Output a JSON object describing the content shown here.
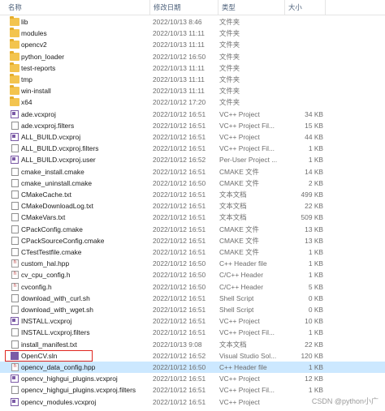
{
  "columns": {
    "name": "名称",
    "date": "修改日期",
    "type": "类型",
    "size": "大小"
  },
  "rows": [
    {
      "icon": "folder",
      "name": "lib",
      "date": "2022/10/13 8:46",
      "type": "文件夹",
      "size": ""
    },
    {
      "icon": "folder",
      "name": "modules",
      "date": "2022/10/13 11:11",
      "type": "文件夹",
      "size": ""
    },
    {
      "icon": "folder",
      "name": "opencv2",
      "date": "2022/10/13 11:11",
      "type": "文件夹",
      "size": ""
    },
    {
      "icon": "folder",
      "name": "python_loader",
      "date": "2022/10/12 16:50",
      "type": "文件夹",
      "size": ""
    },
    {
      "icon": "folder",
      "name": "test-reports",
      "date": "2022/10/13 11:11",
      "type": "文件夹",
      "size": ""
    },
    {
      "icon": "folder",
      "name": "tmp",
      "date": "2022/10/13 11:11",
      "type": "文件夹",
      "size": ""
    },
    {
      "icon": "folder",
      "name": "win-install",
      "date": "2022/10/13 11:11",
      "type": "文件夹",
      "size": ""
    },
    {
      "icon": "folder",
      "name": "x64",
      "date": "2022/10/12 17:20",
      "type": "文件夹",
      "size": ""
    },
    {
      "icon": "vc",
      "name": "ade.vcxproj",
      "date": "2022/10/12 16:51",
      "type": "VC++ Project",
      "size": "34 KB"
    },
    {
      "icon": "doc",
      "name": "ade.vcxproj.filters",
      "date": "2022/10/12 16:51",
      "type": "VC++ Project Fil...",
      "size": "15 KB"
    },
    {
      "icon": "vc",
      "name": "ALL_BUILD.vcxproj",
      "date": "2022/10/12 16:51",
      "type": "VC++ Project",
      "size": "44 KB"
    },
    {
      "icon": "doc",
      "name": "ALL_BUILD.vcxproj.filters",
      "date": "2022/10/12 16:51",
      "type": "VC++ Project Fil...",
      "size": "1 KB"
    },
    {
      "icon": "vc",
      "name": "ALL_BUILD.vcxproj.user",
      "date": "2022/10/12 16:52",
      "type": "Per-User Project ...",
      "size": "1 KB"
    },
    {
      "icon": "doc",
      "name": "cmake_install.cmake",
      "date": "2022/10/12 16:51",
      "type": "CMAKE 文件",
      "size": "14 KB"
    },
    {
      "icon": "doc",
      "name": "cmake_uninstall.cmake",
      "date": "2022/10/12 16:50",
      "type": "CMAKE 文件",
      "size": "2 KB"
    },
    {
      "icon": "doc",
      "name": "CMakeCache.txt",
      "date": "2022/10/12 16:51",
      "type": "文本文档",
      "size": "499 KB"
    },
    {
      "icon": "doc",
      "name": "CMakeDownloadLog.txt",
      "date": "2022/10/12 16:51",
      "type": "文本文档",
      "size": "22 KB"
    },
    {
      "icon": "doc",
      "name": "CMakeVars.txt",
      "date": "2022/10/12 16:51",
      "type": "文本文档",
      "size": "509 KB"
    },
    {
      "icon": "doc",
      "name": "CPackConfig.cmake",
      "date": "2022/10/12 16:51",
      "type": "CMAKE 文件",
      "size": "13 KB"
    },
    {
      "icon": "doc",
      "name": "CPackSourceConfig.cmake",
      "date": "2022/10/12 16:51",
      "type": "CMAKE 文件",
      "size": "13 KB"
    },
    {
      "icon": "doc",
      "name": "CTestTestfile.cmake",
      "date": "2022/10/12 16:51",
      "type": "CMAKE 文件",
      "size": "1 KB"
    },
    {
      "icon": "h",
      "name": "custom_hal.hpp",
      "date": "2022/10/12 16:50",
      "type": "C++ Header file",
      "size": "1 KB"
    },
    {
      "icon": "h",
      "name": "cv_cpu_config.h",
      "date": "2022/10/12 16:50",
      "type": "C/C++ Header",
      "size": "1 KB"
    },
    {
      "icon": "h",
      "name": "cvconfig.h",
      "date": "2022/10/12 16:50",
      "type": "C/C++ Header",
      "size": "5 KB"
    },
    {
      "icon": "doc",
      "name": "download_with_curl.sh",
      "date": "2022/10/12 16:51",
      "type": "Shell Script",
      "size": "0 KB"
    },
    {
      "icon": "doc",
      "name": "download_with_wget.sh",
      "date": "2022/10/12 16:51",
      "type": "Shell Script",
      "size": "0 KB"
    },
    {
      "icon": "vc",
      "name": "INSTALL.vcxproj",
      "date": "2022/10/12 16:51",
      "type": "VC++ Project",
      "size": "10 KB"
    },
    {
      "icon": "doc",
      "name": "INSTALL.vcxproj.filters",
      "date": "2022/10/12 16:51",
      "type": "VC++ Project Fil...",
      "size": "1 KB"
    },
    {
      "icon": "doc",
      "name": "install_manifest.txt",
      "date": "2022/10/13 9:08",
      "type": "文本文档",
      "size": "22 KB"
    },
    {
      "icon": "sln",
      "name": "OpenCV.sln",
      "date": "2022/10/12 16:52",
      "type": "Visual Studio Sol...",
      "size": "120 KB"
    },
    {
      "icon": "h",
      "name": "opencv_data_config.hpp",
      "date": "2022/10/12 16:50",
      "type": "C++ Header file",
      "size": "1 KB"
    },
    {
      "icon": "vc",
      "name": "opencv_highgui_plugins.vcxproj",
      "date": "2022/10/12 16:51",
      "type": "VC++ Project",
      "size": "12 KB"
    },
    {
      "icon": "doc",
      "name": "opencv_highgui_plugins.vcxproj.filters",
      "date": "2022/10/12 16:51",
      "type": "VC++ Project Fil...",
      "size": "1 KB"
    },
    {
      "icon": "vc",
      "name": "opencv_modules.vcxproj",
      "date": "2022/10/12 16:51",
      "type": "VC++ Project",
      "size": ""
    }
  ],
  "selected_index": 30,
  "highlighted_index": 29,
  "watermark": "CSDN @python小广",
  "colors": {
    "selection": "#cce8ff",
    "highlight_border": "#e0261f",
    "folder": "#f3c44e"
  }
}
